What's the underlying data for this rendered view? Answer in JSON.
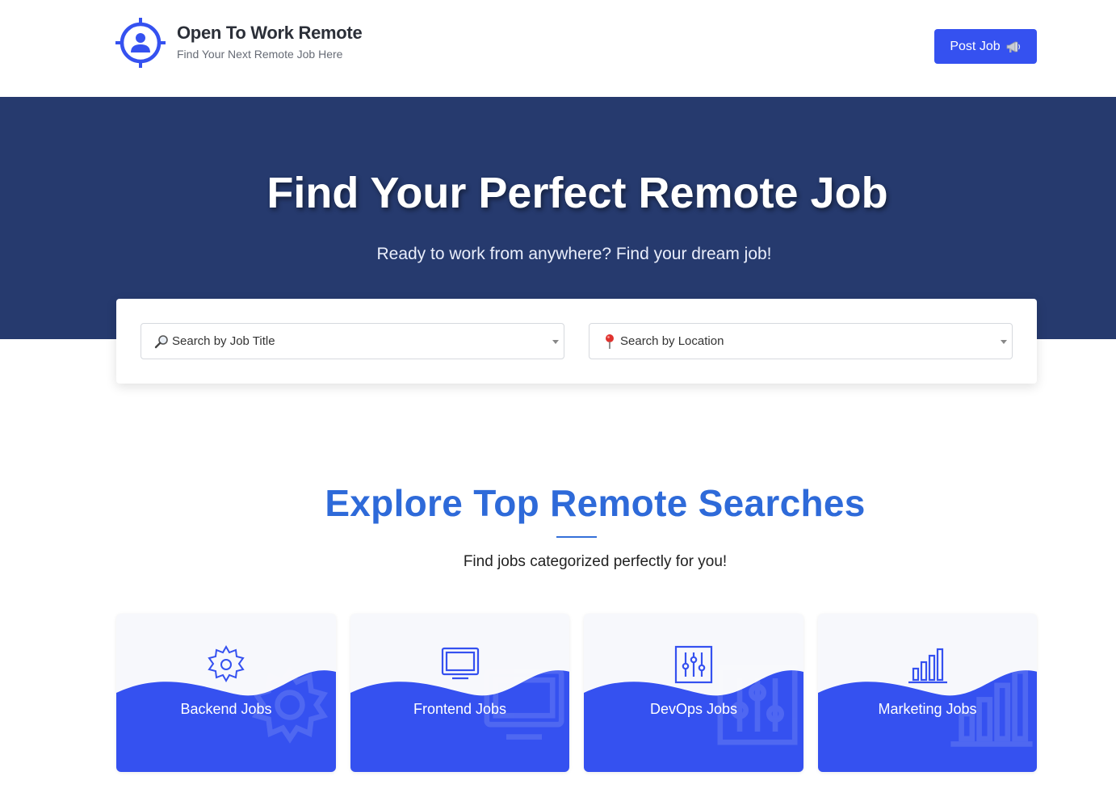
{
  "header": {
    "brand_title": "Open To Work Remote",
    "brand_subtitle": "Find Your Next Remote Job Here",
    "logo_icon": "target-person-icon",
    "post_job_label": "Post Job",
    "post_job_icon": "megaphone-icon"
  },
  "hero": {
    "title": "Find Your Perfect Remote Job",
    "subtitle": "Ready to work from anywhere? Find your dream job!"
  },
  "search": {
    "job_title_placeholder": "Search by Job Title",
    "job_title_icon": "magnifier-icon",
    "location_placeholder": "Search by Location",
    "location_icon": "map-pin-icon"
  },
  "explore": {
    "title": "Explore Top Remote Searches",
    "subtitle": "Find jobs categorized perfectly for you!"
  },
  "categories": [
    {
      "label": "Backend Jobs",
      "icon": "gear-icon"
    },
    {
      "label": "Frontend Jobs",
      "icon": "monitor-icon"
    },
    {
      "label": "DevOps Jobs",
      "icon": "sliders-icon"
    },
    {
      "label": "Marketing Jobs",
      "icon": "bar-chart-icon"
    }
  ],
  "colors": {
    "primary": "#3551f0",
    "hero_bg": "#263a6e",
    "section_title": "#2e6ad9"
  }
}
